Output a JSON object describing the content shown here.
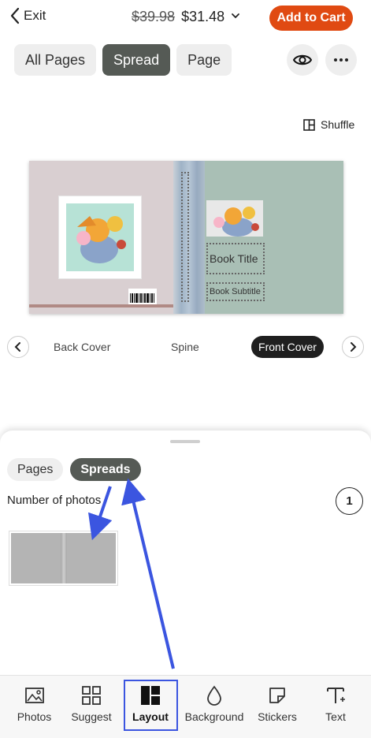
{
  "topbar": {
    "exit_label": "Exit",
    "old_price": "$39.98",
    "new_price": "$31.48",
    "add_to_cart": "Add to Cart"
  },
  "view_tabs": [
    "All Pages",
    "Spread",
    "Page"
  ],
  "active_view_tab": "Spread",
  "shuffle_label": "Shuffle",
  "book": {
    "title": "Book Title",
    "subtitle": "Book Subtitle"
  },
  "cover_nav": {
    "back": "Back Cover",
    "spine": "Spine",
    "front": "Front Cover",
    "active": "Front Cover"
  },
  "sheet": {
    "tabs": [
      "Pages",
      "Spreads"
    ],
    "active_tab": "Spreads",
    "number_label": "Number of photos",
    "number_value": "1"
  },
  "toolbar": {
    "items": [
      "Photos",
      "Suggest",
      "Layout",
      "Background",
      "Stickers",
      "Text"
    ],
    "active": "Layout"
  },
  "colors": {
    "accent": "#e04a12",
    "active_tab": "#555a55",
    "highlight": "#3b55e0",
    "back_cover": "#d9cfd1",
    "front_cover": "#a9bfb5"
  }
}
